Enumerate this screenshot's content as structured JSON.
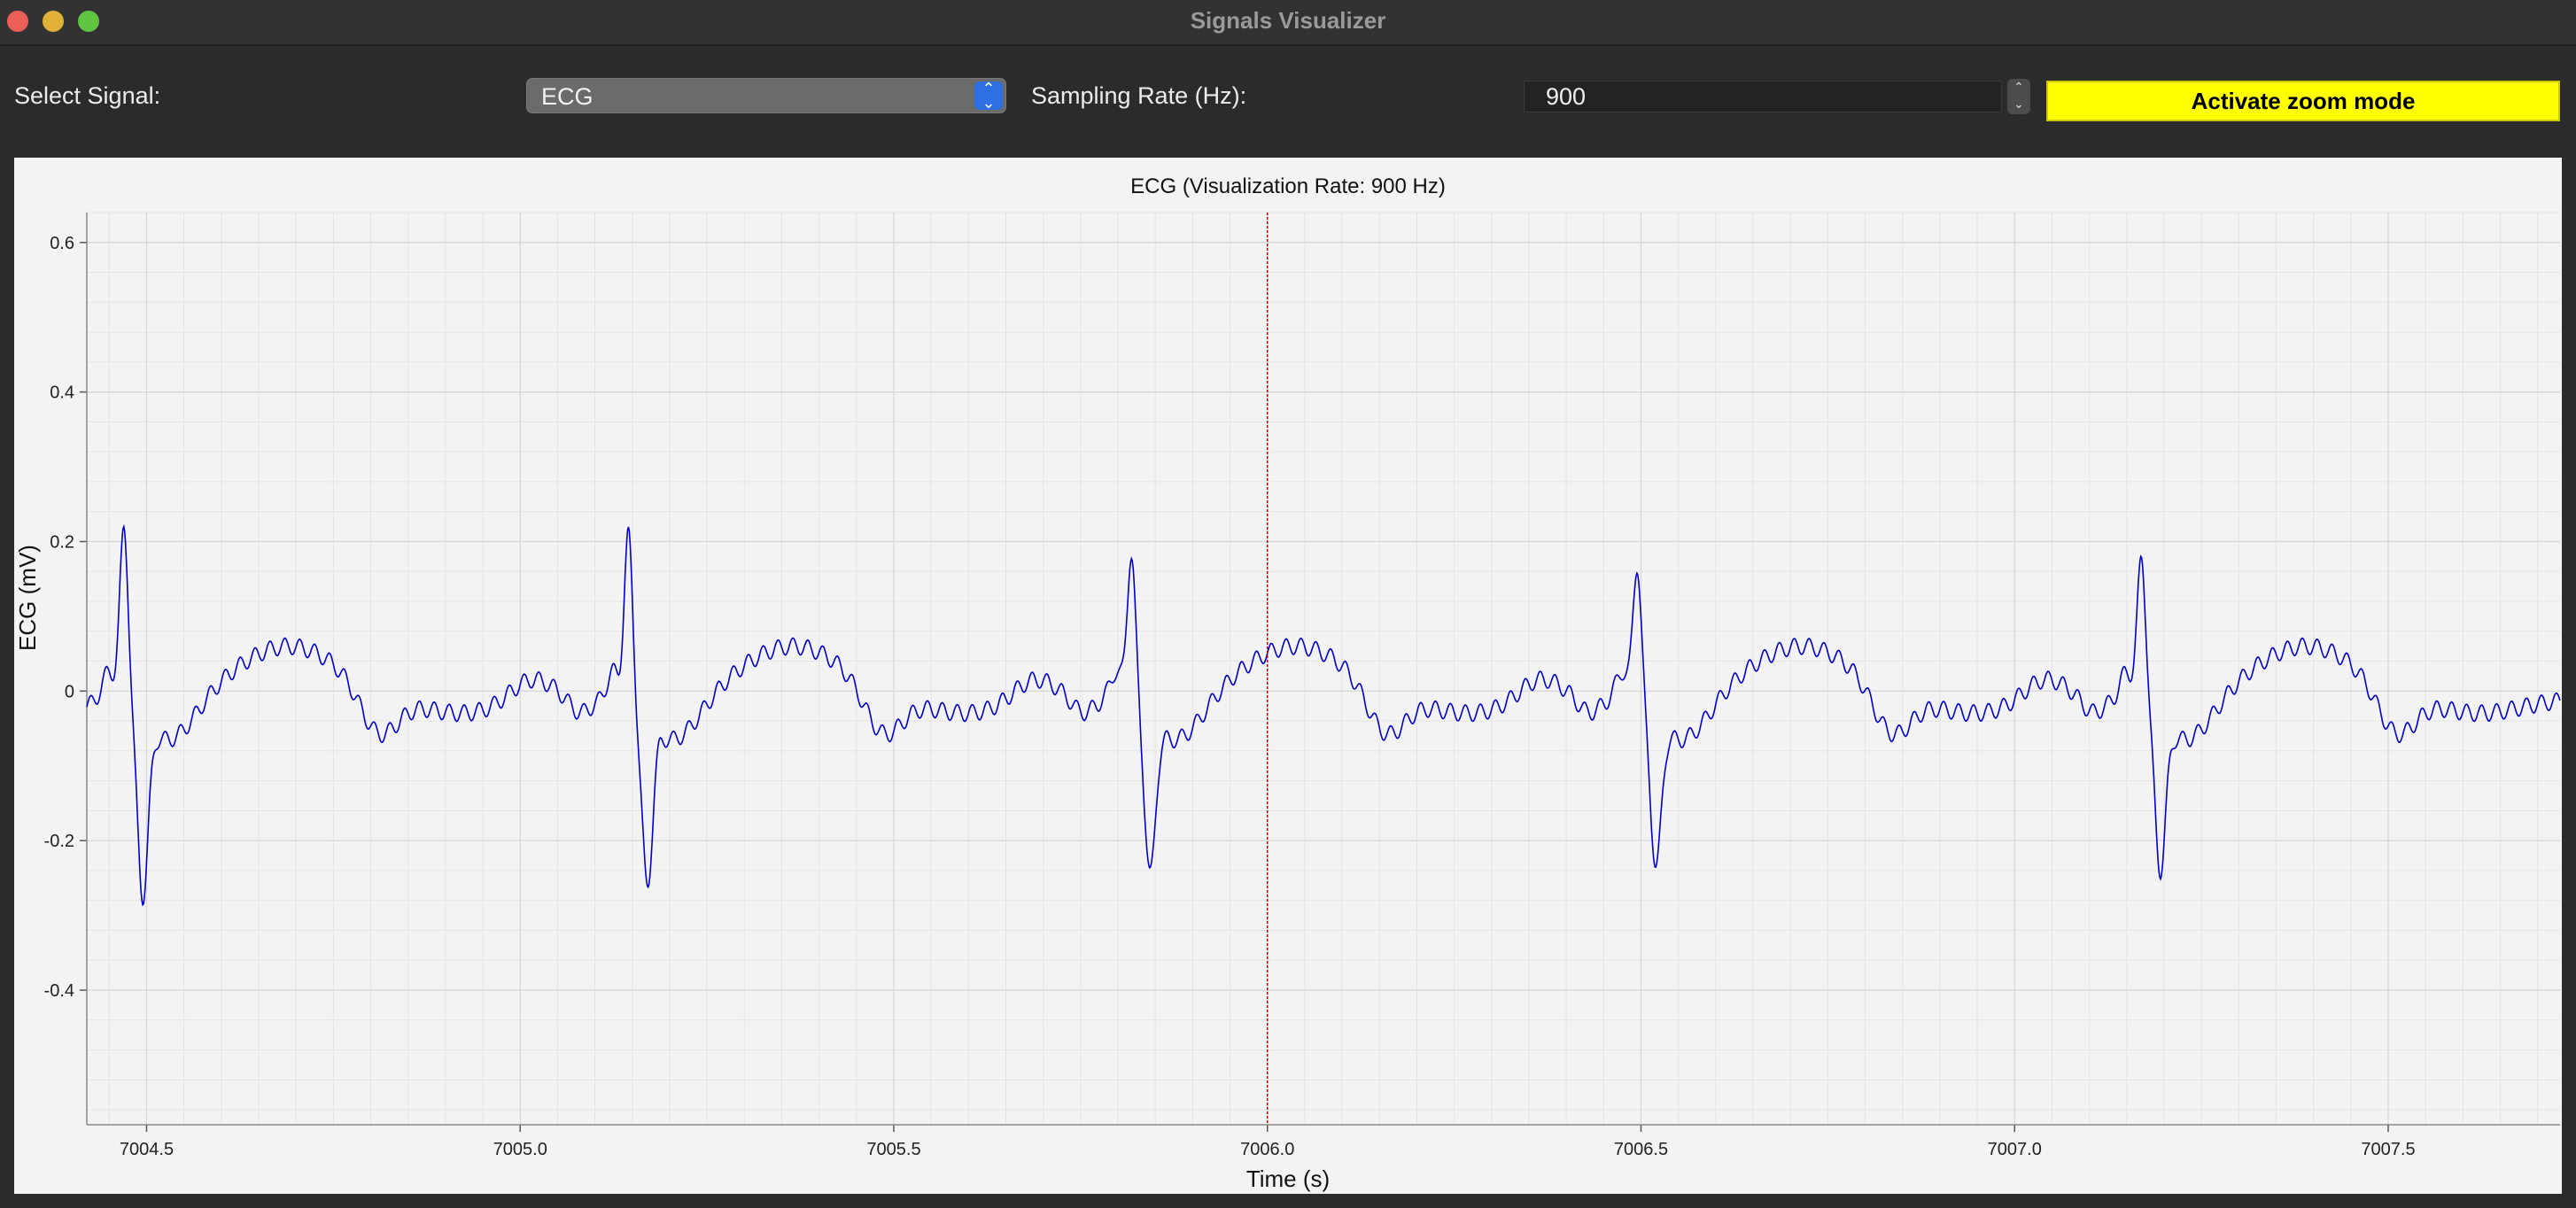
{
  "window": {
    "title": "Signals Visualizer"
  },
  "controls": {
    "signal_label": "Select Signal:",
    "signal_value": "ECG",
    "rate_label": "Sampling Rate (Hz):",
    "rate_value": "900",
    "zoom_button": "Activate zoom mode"
  },
  "icons": {
    "select": "chevron-up-down-icon",
    "spin_up": "chevron-up-icon",
    "spin_down": "chevron-down-icon"
  },
  "colors": {
    "accent": "#2f6fe4",
    "zoom_button": "#ffff00",
    "signal_line": "#0000cc",
    "cursor_line": "#cc0000"
  },
  "chart_data": {
    "type": "line",
    "title": "ECG (Visualization Rate: 900 Hz)",
    "xlabel": "Time (s)",
    "ylabel": "ECG (mV)",
    "xlim": [
      7004.42,
      7007.73
    ],
    "ylim": [
      -0.58,
      0.64
    ],
    "x_ticks": [
      7004.5,
      7005.0,
      7005.5,
      7006.0,
      7006.5,
      7007.0,
      7007.5
    ],
    "x_tick_labels": [
      "7004.5",
      "7005.0",
      "7005.5",
      "7006.0",
      "7006.5",
      "7007.0",
      "7007.5"
    ],
    "y_ticks": [
      0.6,
      0.4,
      0.2,
      0,
      -0.2,
      -0.4
    ],
    "y_tick_labels": [
      "0.6",
      "0.4",
      "0.2",
      "0",
      "-0.2",
      "-0.4"
    ],
    "grid": true,
    "cursor_x": 7006.0,
    "r_peak_times": [
      7004.47,
      7005.145,
      7005.818,
      7006.495,
      7007.17
    ],
    "r_peak_values": [
      0.24,
      0.23,
      0.205,
      0.19,
      0.2
    ],
    "s_trough_values": [
      -0.21,
      -0.195,
      -0.18,
      -0.17,
      -0.175
    ],
    "series": [
      {
        "values_note_free": true
      }
    ]
  }
}
